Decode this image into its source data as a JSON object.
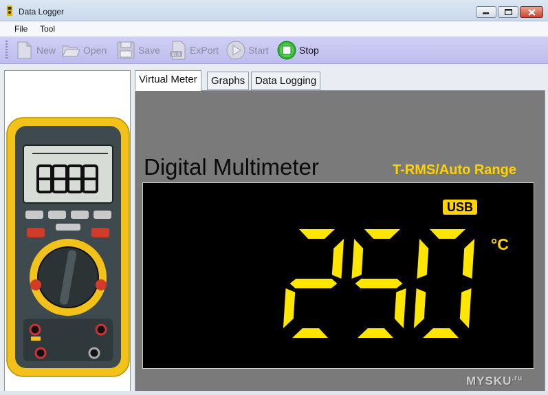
{
  "window": {
    "title": "Data Logger"
  },
  "menu": {
    "items": [
      "File",
      "Tool"
    ]
  },
  "toolbar": {
    "new_label": "New",
    "open_label": "Open",
    "save_label": "Save",
    "export_label": "ExPort",
    "start_label": "Start",
    "stop_label": "Stop"
  },
  "tabs": [
    "Virtual Meter",
    "Graphs",
    "Data Logging"
  ],
  "meter": {
    "title": "Digital Multimeter",
    "subtitle": "T-RMS/Auto Range",
    "usb_badge": "USB",
    "reading": "250",
    "unit": "°C"
  },
  "watermark": {
    "text": "MYSKU",
    "suffix": ".ru"
  },
  "colors": {
    "accent_yellow": "#ffd200",
    "display_bg": "#000000",
    "toolbar_bg": "#c6c6f2",
    "meter_bg": "#7a7a7a"
  }
}
